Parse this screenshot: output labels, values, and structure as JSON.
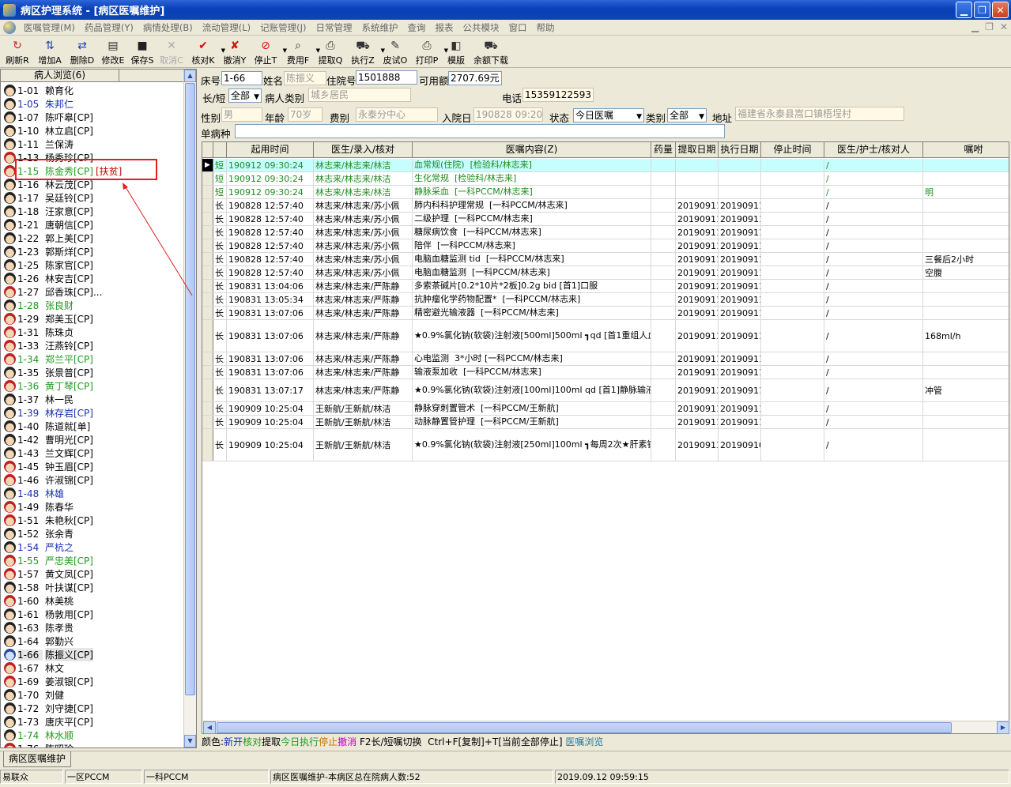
{
  "window": {
    "title": "病区护理系统 - [病区医嘱维护]"
  },
  "menu": [
    "医嘱管理(M)",
    "药品管理(Y)",
    "病情处理(B)",
    "流动管理(L)",
    "记账管理(J)",
    "日常管理",
    "系统维护",
    "查询",
    "报表",
    "公共模块",
    "窗口",
    "帮助"
  ],
  "toolbar": [
    {
      "label": "刷新R",
      "icon": "refresh-icon",
      "glyph": "↻",
      "color": "#d02020",
      "enabled": true
    },
    {
      "label": "增加A",
      "icon": "add-icon",
      "glyph": "⇅",
      "color": "#2040c0",
      "enabled": true
    },
    {
      "label": "删除D",
      "icon": "delete-icon",
      "glyph": "⇄",
      "color": "#2040c0",
      "enabled": true
    },
    {
      "label": "修改E",
      "icon": "edit-icon",
      "glyph": "▤",
      "color": "#333",
      "enabled": true
    },
    {
      "label": "保存S",
      "icon": "save-icon",
      "glyph": "■",
      "color": "#222",
      "enabled": true
    },
    {
      "label": "取消C",
      "icon": "cancel-icon",
      "glyph": "✕",
      "color": "#aaa",
      "enabled": false
    },
    {
      "label": "核对K",
      "icon": "check-icon",
      "glyph": "✔",
      "color": "#d01010",
      "enabled": true,
      "dropdown": true
    },
    {
      "label": "撤消Y",
      "icon": "undo-icon",
      "glyph": "✘",
      "color": "#d01010",
      "enabled": true
    },
    {
      "label": "停止T",
      "icon": "stop-icon",
      "glyph": "⊘",
      "color": "#d01010",
      "enabled": true,
      "dropdown": true
    },
    {
      "label": "费用F",
      "icon": "fee-icon",
      "glyph": "⌕",
      "color": "#333",
      "enabled": true,
      "dropdown": true
    },
    {
      "label": "提取Q",
      "icon": "extract-icon",
      "glyph": "⎙",
      "color": "#333",
      "enabled": true
    },
    {
      "label": "执行Z",
      "icon": "execute-icon",
      "glyph": "⛟",
      "color": "#333",
      "enabled": true,
      "dropdown": true
    },
    {
      "label": "皮试O",
      "icon": "skin-test-icon",
      "glyph": "✎",
      "color": "#333",
      "enabled": true
    },
    {
      "label": "打印P",
      "icon": "print-icon",
      "glyph": "⎙",
      "color": "#333",
      "enabled": true,
      "dropdown": true
    },
    {
      "label": "模版",
      "icon": "template-icon",
      "glyph": "◧",
      "color": "#333",
      "enabled": true
    },
    {
      "label": "余额下载",
      "icon": "download-icon",
      "glyph": "⛟",
      "color": "#333",
      "enabled": true
    }
  ],
  "patient_panel": {
    "header": "病人浏览(6)",
    "patients": [
      {
        "bed": "1-01",
        "name": "赖育化",
        "color": "black",
        "avatar": "m"
      },
      {
        "bed": "1-05",
        "name": "朱邦仁",
        "color": "blue",
        "avatar": "m"
      },
      {
        "bed": "1-07",
        "name": "陈吓皋[CP]",
        "color": "black",
        "avatar": "m"
      },
      {
        "bed": "1-10",
        "name": "林立启[CP]",
        "color": "black",
        "avatar": "m"
      },
      {
        "bed": "1-11",
        "name": "兰保涛",
        "color": "black",
        "avatar": "m"
      },
      {
        "bed": "1-13",
        "name": "杨秀珍[CP]",
        "color": "black",
        "avatar": "f"
      },
      {
        "bed": "1-15",
        "name": "陈金秀[CP]",
        "color": "green",
        "avatar": "f",
        "tag": "[扶贫]"
      },
      {
        "bed": "1-16",
        "name": "林云茂[CP]",
        "color": "black",
        "avatar": "m"
      },
      {
        "bed": "1-17",
        "name": "吴廷铃[CP]",
        "color": "black",
        "avatar": "m"
      },
      {
        "bed": "1-18",
        "name": "汪家意[CP]",
        "color": "black",
        "avatar": "m"
      },
      {
        "bed": "1-21",
        "name": "唐朝信[CP]",
        "color": "black",
        "avatar": "m"
      },
      {
        "bed": "1-22",
        "name": "郭上美[CP]",
        "color": "black",
        "avatar": "m"
      },
      {
        "bed": "1-23",
        "name": "郭斯烊[CP]",
        "color": "black",
        "avatar": "m"
      },
      {
        "bed": "1-25",
        "name": "陈家官[CP]",
        "color": "black",
        "avatar": "m"
      },
      {
        "bed": "1-26",
        "name": "林安吉[CP]",
        "color": "black",
        "avatar": "m"
      },
      {
        "bed": "1-27",
        "name": "邱香珠[CP]...",
        "color": "black",
        "avatar": "f"
      },
      {
        "bed": "1-28",
        "name": "张良财",
        "color": "green",
        "avatar": "m"
      },
      {
        "bed": "1-29",
        "name": "郑美玉[CP]",
        "color": "black",
        "avatar": "f"
      },
      {
        "bed": "1-31",
        "name": "陈珠贞",
        "color": "black",
        "avatar": "f"
      },
      {
        "bed": "1-33",
        "name": "汪燕铃[CP]",
        "color": "black",
        "avatar": "f"
      },
      {
        "bed": "1-34",
        "name": "郑兰平[CP]",
        "color": "green",
        "avatar": "f"
      },
      {
        "bed": "1-35",
        "name": "张景普[CP]",
        "color": "black",
        "avatar": "m"
      },
      {
        "bed": "1-36",
        "name": "黄丁琴[CP]",
        "color": "green",
        "avatar": "f"
      },
      {
        "bed": "1-37",
        "name": "林一民",
        "color": "black",
        "avatar": "m"
      },
      {
        "bed": "1-39",
        "name": "林存岩[CP]",
        "color": "blue",
        "avatar": "m"
      },
      {
        "bed": "1-40",
        "name": "陈道就[单]",
        "color": "black",
        "avatar": "m"
      },
      {
        "bed": "1-42",
        "name": "曹明光[CP]",
        "color": "black",
        "avatar": "m"
      },
      {
        "bed": "1-43",
        "name": "兰文辉[CP]",
        "color": "black",
        "avatar": "m"
      },
      {
        "bed": "1-45",
        "name": "钟玉眉[CP]",
        "color": "black",
        "avatar": "f"
      },
      {
        "bed": "1-46",
        "name": "许淑锦[CP]",
        "color": "black",
        "avatar": "f"
      },
      {
        "bed": "1-48",
        "name": "林雄",
        "color": "blue",
        "avatar": "m"
      },
      {
        "bed": "1-49",
        "name": "陈春华",
        "color": "black",
        "avatar": "f"
      },
      {
        "bed": "1-51",
        "name": "朱艳秋[CP]",
        "color": "black",
        "avatar": "f"
      },
      {
        "bed": "1-52",
        "name": "张余青",
        "color": "black",
        "avatar": "m"
      },
      {
        "bed": "1-54",
        "name": "严杭之",
        "color": "blue",
        "avatar": "m"
      },
      {
        "bed": "1-55",
        "name": "严忠美[CP]",
        "color": "green",
        "avatar": "f"
      },
      {
        "bed": "1-57",
        "name": "黄文凤[CP]",
        "color": "black",
        "avatar": "f"
      },
      {
        "bed": "1-58",
        "name": "叶扶谋[CP]",
        "color": "black",
        "avatar": "m"
      },
      {
        "bed": "1-60",
        "name": "林美桃",
        "color": "black",
        "avatar": "f"
      },
      {
        "bed": "1-61",
        "name": "杨敦用[CP]",
        "color": "black",
        "avatar": "m"
      },
      {
        "bed": "1-63",
        "name": "陈孝贵",
        "color": "black",
        "avatar": "m"
      },
      {
        "bed": "1-64",
        "name": "郭勤兴",
        "color": "black",
        "avatar": "m"
      },
      {
        "bed": "1-66",
        "name": "陈振义[CP]",
        "color": "black",
        "avatar": "s",
        "selected": true
      },
      {
        "bed": "1-67",
        "name": "林文",
        "color": "black",
        "avatar": "f"
      },
      {
        "bed": "1-69",
        "name": "姜淑银[CP]",
        "color": "black",
        "avatar": "f"
      },
      {
        "bed": "1-70",
        "name": "刘健",
        "color": "black",
        "avatar": "m"
      },
      {
        "bed": "1-72",
        "name": "刘守捷[CP]",
        "color": "black",
        "avatar": "m"
      },
      {
        "bed": "1-73",
        "name": "唐庆平[CP]",
        "color": "black",
        "avatar": "m"
      },
      {
        "bed": "1-74",
        "name": "林水顺",
        "color": "green",
        "avatar": "m"
      },
      {
        "bed": "1-76",
        "name": "陈昭珍",
        "color": "black",
        "avatar": "f"
      }
    ]
  },
  "form": {
    "bed_label": "床号",
    "bed": "1-66",
    "name_label": "姓名",
    "name": "陈振义",
    "inpatient_label": "住院号",
    "inpatient_no": "1501888",
    "balance_label": "可用额",
    "balance": "2707.69元",
    "order_type_label": "长/短",
    "order_type": "全部",
    "patient_type_label": "病人类别",
    "patient_type": "城乡居民",
    "phone_label": "电话",
    "phone": "15359122593",
    "sex_label": "性别",
    "sex": "男",
    "age_label": "年龄",
    "age": "70岁",
    "fee_label": "费别",
    "fee": "永泰分中心",
    "admit_label": "入院日",
    "admit_date": "190828 09:20",
    "status_label": "状态",
    "status": "今日医嘱",
    "category_label": "类别",
    "category": "全部",
    "address_label": "地址",
    "address": "福建省永泰县嵩口镇梧埕村",
    "disease_label": "单病种",
    "disease": ""
  },
  "orders_grid": {
    "columns": [
      "",
      "",
      "起用时间",
      "医生/录入/核对",
      "医嘱内容(Z)",
      "药量",
      "提取日期",
      "执行日期",
      "停止时间",
      "医生/护士/核对人",
      "嘱咐"
    ],
    "rows": [
      {
        "type": "短",
        "start": "190912 09:30:24",
        "doctors": "林志来/林志来/林洁",
        "content": [
          "血常规(住院)  [检验科/林志来]"
        ],
        "dose": "",
        "fetch": "",
        "exec": "",
        "stop": "",
        "nurse": "/",
        "remark": "",
        "current": true,
        "short": true
      },
      {
        "type": "短",
        "start": "190912 09:30:24",
        "doctors": "林志来/林志来/林洁",
        "content": [
          "生化常规  [检验科/林志来]"
        ],
        "dose": "",
        "fetch": "",
        "exec": "",
        "stop": "",
        "nurse": "/",
        "remark": "",
        "short": true
      },
      {
        "type": "短",
        "start": "190912 09:30:24",
        "doctors": "林志来/林志来/林洁",
        "content": [
          "静脉采血  [一科PCCM/林志来]"
        ],
        "dose": "",
        "fetch": "",
        "exec": "",
        "stop": "",
        "nurse": "/",
        "remark": "明",
        "short": true
      },
      {
        "type": "长",
        "start": "190828 12:57:40",
        "doctors": "林志来/林志来/苏小佩",
        "content": [
          "肺内科科护理常规  [一科PCCM/林志来]"
        ],
        "dose": "",
        "fetch": "20190911",
        "exec": "20190911",
        "stop": "",
        "nurse": "/",
        "remark": ""
      },
      {
        "type": "长",
        "start": "190828 12:57:40",
        "doctors": "林志来/林志来/苏小佩",
        "content": [
          "二级护理  [一科PCCM/林志来]"
        ],
        "dose": "",
        "fetch": "20190911",
        "exec": "20190911",
        "stop": "",
        "nurse": "/",
        "remark": ""
      },
      {
        "type": "长",
        "start": "190828 12:57:40",
        "doctors": "林志来/林志来/苏小佩",
        "content": [
          "糖尿病饮食  [一科PCCM/林志来]"
        ],
        "dose": "",
        "fetch": "20190911",
        "exec": "20190911",
        "stop": "",
        "nurse": "/",
        "remark": ""
      },
      {
        "type": "长",
        "start": "190828 12:57:40",
        "doctors": "林志来/林志来/苏小佩",
        "content": [
          "陪伴  [一科PCCM/林志来]"
        ],
        "dose": "",
        "fetch": "20190911",
        "exec": "20190911",
        "stop": "",
        "nurse": "/",
        "remark": ""
      },
      {
        "type": "长",
        "start": "190828 12:57:40",
        "doctors": "林志来/林志来/苏小佩",
        "content": [
          "电脑血糖监测 tid  [一科PCCM/林志来]"
        ],
        "dose": "",
        "fetch": "20190911",
        "exec": "20190911",
        "stop": "",
        "nurse": "/",
        "remark": "三餐后2小时"
      },
      {
        "type": "长",
        "start": "190828 12:57:40",
        "doctors": "林志来/林志来/苏小佩",
        "content": [
          "电脑血糖监测  [一科PCCM/林志来]"
        ],
        "dose": "",
        "fetch": "20190911",
        "exec": "20190911",
        "stop": "",
        "nurse": "/",
        "remark": "空腹"
      },
      {
        "type": "长",
        "start": "190831 13:04:06",
        "doctors": "林志来/林志来/严陈静",
        "content": [
          "多索茶碱片[0.2*10片*2板]0.2g bid [首1]口服"
        ],
        "dose": "",
        "fetch": "20190912",
        "exec": "20190911",
        "stop": "",
        "nurse": "/",
        "remark": ""
      },
      {
        "type": "长",
        "start": "190831 13:05:34",
        "doctors": "林志来/林志来/严陈静",
        "content": [
          "抗肿瘤化学药物配置*  [一科PCCM/林志来]"
        ],
        "dose": "",
        "fetch": "20190911",
        "exec": "20190911",
        "stop": "",
        "nurse": "/",
        "remark": ""
      },
      {
        "type": "长",
        "start": "190831 13:07:06",
        "doctors": "林志来/林志来/严陈静",
        "content": [
          "精密避光输液器  [一科PCCM/林志来]"
        ],
        "dose": "",
        "fetch": "20190911",
        "exec": "20190911",
        "stop": "",
        "nurse": "/",
        "remark": ""
      },
      {
        "type": "长",
        "start": "190831 13:07:06",
        "doctors": "林志来/林志来/严陈静",
        "content": [
          "★0.9%氯化钠(软袋)注射液[500ml]500ml ┓qd [首1",
          "重组人血管内皮抑制素注射液[3ml:15mg]15m ┃]静脉输",
          "g                                         ┛液"
        ],
        "dose": "",
        "fetch": "20190913",
        "exec": "20190911",
        "stop": "",
        "nurse": "/",
        "remark": "168ml/h"
      },
      {
        "type": "长",
        "start": "190831 13:07:06",
        "doctors": "林志来/林志来/严陈静",
        "content": [
          "心电监测  3*小时 [一科PCCM/林志来]"
        ],
        "dose": "",
        "fetch": "20190911",
        "exec": "20190911",
        "stop": "",
        "nurse": "/",
        "remark": ""
      },
      {
        "type": "长",
        "start": "190831 13:07:06",
        "doctors": "林志来/林志来/严陈静",
        "content": [
          "输液泵加收  [一科PCCM/林志来]"
        ],
        "dose": "",
        "fetch": "20190911",
        "exec": "20190911",
        "stop": "",
        "nurse": "/",
        "remark": ""
      },
      {
        "type": "长",
        "start": "190831 13:07:17",
        "doctors": "林志来/林志来/严陈静",
        "content": [
          "★0.9%氯化钠(软袋)注射液[100ml]100ml qd [首1]静",
          "脉输液"
        ],
        "dose": "",
        "fetch": "20190913",
        "exec": "20190911",
        "stop": "",
        "nurse": "/",
        "remark": "冲管"
      },
      {
        "type": "长",
        "start": "190909 10:25:04",
        "doctors": "王新航/王新航/林洁",
        "content": [
          "静脉穿刺置管术  [一科PCCM/王新航]"
        ],
        "dose": "",
        "fetch": "20190911",
        "exec": "20190911",
        "stop": "",
        "nurse": "/",
        "remark": ""
      },
      {
        "type": "长",
        "start": "190909 10:25:04",
        "doctors": "王新航/王新航/林洁",
        "content": [
          "动脉静置管护理  [一科PCCM/王新航]"
        ],
        "dose": "",
        "fetch": "20190911",
        "exec": "20190911",
        "stop": "",
        "nurse": "/",
        "remark": ""
      },
      {
        "type": "长",
        "start": "190909 10:25:04",
        "doctors": "王新航/王新航/林洁",
        "content": [
          "★0.9%氯化钠(软袋)注射液[250ml]100ml ┓每周2次",
          "★肝素钠注射液(万邦)[2ml:12500u*10支]1 ┃(二/五)",
          "250u                                    ┛抗凝"
        ],
        "dose": "",
        "fetch": "20190913",
        "exec": "20190910",
        "stop": "",
        "nurse": "/",
        "remark": ""
      }
    ]
  },
  "legend": {
    "prefix": "颜色:",
    "items": [
      {
        "t": "新开",
        "c": "#1a2fb0"
      },
      {
        "t": "核对",
        "c": "#1f9a1f"
      },
      {
        "t": "提取",
        "c": "#000"
      },
      {
        "t": "今日执行",
        "c": "#1f9a1f"
      },
      {
        "t": "停止",
        "c": "#d07000"
      },
      {
        "t": "撤消",
        "c": "#c000c0"
      }
    ],
    "hint": " F2长/短嘱切换  Ctrl+F[复制]+T[当前全部停止] ",
    "browse": "医嘱浏览",
    "browse_color": "#2a7a9a"
  },
  "tab": {
    "label": "病区医嘱维护"
  },
  "status": {
    "user": "易联众",
    "ward": "一区PCCM",
    "dept": "一科PCCM",
    "msg": "病区医嘱维护-本病区总在院病人数:52",
    "datetime": "2019.09.12 09:59:15"
  },
  "annotation": {
    "color": "#e02020"
  }
}
